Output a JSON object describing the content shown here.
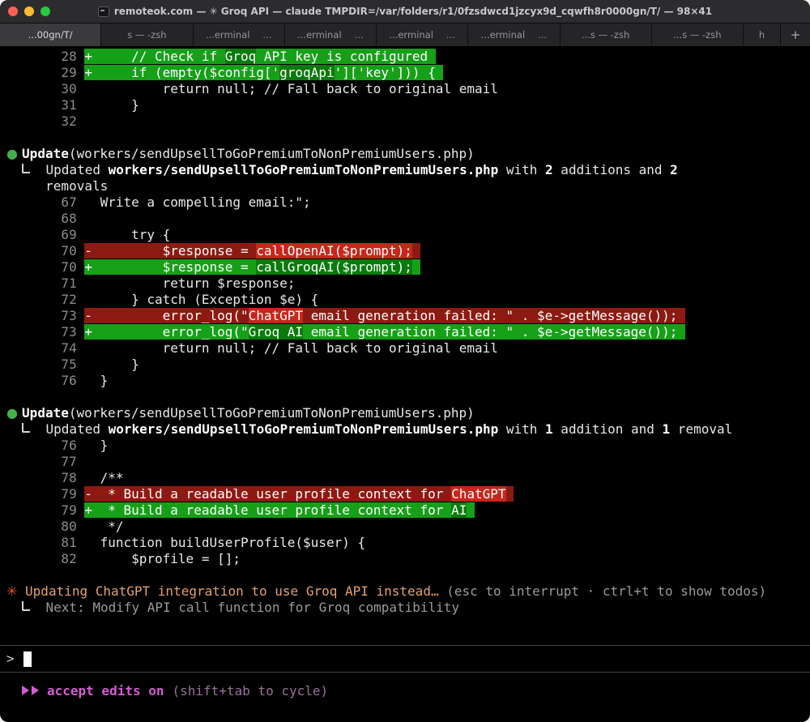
{
  "window": {
    "title": "remoteok.com — ✳ Groq API — claude TMPDIR=/var/folders/r1/0fzsdwcd1jzcyx9d_cqwfh8r0000gn/T/ — 98×41"
  },
  "tabbar": {
    "new_tab_label": "+",
    "tabs": [
      {
        "label": "...00gn/T/",
        "active": true
      },
      {
        "label": "s — -zsh"
      },
      {
        "label": "...erminal",
        "suffix": "..."
      },
      {
        "label": "...erminal",
        "suffix": "..."
      },
      {
        "label": "...erminal",
        "suffix": "..."
      },
      {
        "label": "...erminal",
        "suffix": "..."
      },
      {
        "label": "...s — -zsh"
      },
      {
        "label": "...s — -zsh"
      },
      {
        "label": "h",
        "narrow": true
      }
    ]
  },
  "colors": {
    "added_line_bg": "#16a018",
    "added_word_bg": "#0b7a0d",
    "removed_line_bg": "#8d1a12",
    "removed_word_bg": "#c8261a",
    "bullet_green": "#43b14b",
    "status_orange": "#e5a266",
    "spinner_orange": "#dd512e",
    "mode_magenta": "#d05ed0",
    "mode_magenta_dim": "#9a6f9e"
  },
  "input": {
    "prompt": ">"
  },
  "footer": {
    "icon": "fast-forward",
    "label": "accept edits on",
    "hint": "(shift+tab to cycle)"
  },
  "terminal": {
    "lines": [
      {
        "name": "diff-line-added",
        "parts": [
          {
            "t": "       28 ",
            "cls": "gutter"
          },
          {
            "t": "+     // Check if ",
            "cls": "add"
          },
          {
            "t": "Groq",
            "cls": "addhl"
          },
          {
            "t": " API key is configured ",
            "cls": "add"
          }
        ]
      },
      {
        "name": "diff-line-added",
        "parts": [
          {
            "t": "       29 ",
            "cls": "gutter"
          },
          {
            "t": "+     if (empty($config['",
            "cls": "add"
          },
          {
            "t": "groqApi",
            "cls": "addhl"
          },
          {
            "t": "']['key'])) { ",
            "cls": "add"
          }
        ]
      },
      {
        "name": "diff-context-line",
        "parts": [
          {
            "t": "       30 ",
            "cls": "gutter"
          },
          {
            "t": "          return null; // Fall back to original email",
            "cls": "ctx"
          }
        ]
      },
      {
        "name": "diff-context-line",
        "parts": [
          {
            "t": "       31 ",
            "cls": "gutter"
          },
          {
            "t": "      }",
            "cls": "ctx"
          }
        ]
      },
      {
        "name": "diff-context-line",
        "parts": [
          {
            "t": "       32",
            "cls": "gutter"
          }
        ]
      },
      {
        "name": "blank-line",
        "parts": []
      },
      {
        "name": "tool-call-header",
        "parts": [
          {
            "t": "● ",
            "cls": "bullet"
          },
          {
            "t": "Update",
            "cls": "b"
          },
          {
            "t": "(workers/sendUpsellToGoPremiumToNonPremiumUsers.php)",
            "cls": "ctx"
          }
        ]
      },
      {
        "name": "tool-result-summary",
        "parts": [
          {
            "t": "  ",
            "cls": "ctx"
          },
          {
            "icon": "elbow"
          },
          {
            "t": "  Updated ",
            "cls": "ctx"
          },
          {
            "t": "workers/sendUpsellToGoPremiumToNonPremiumUsers.php",
            "cls": "b"
          },
          {
            "t": " with ",
            "cls": "ctx"
          },
          {
            "t": "2",
            "cls": "b"
          },
          {
            "t": " additions and ",
            "cls": "ctx"
          },
          {
            "t": "2",
            "cls": "b"
          }
        ]
      },
      {
        "name": "tool-result-summary",
        "parts": [
          {
            "t": "     removals",
            "cls": "ctx"
          }
        ]
      },
      {
        "name": "diff-context-line",
        "parts": [
          {
            "t": "       67 ",
            "cls": "gutter"
          },
          {
            "t": "  Write a compelling email:\";",
            "cls": "ctx"
          }
        ]
      },
      {
        "name": "diff-context-line",
        "parts": [
          {
            "t": "       68",
            "cls": "gutter"
          }
        ]
      },
      {
        "name": "diff-context-line",
        "parts": [
          {
            "t": "       69 ",
            "cls": "gutter"
          },
          {
            "t": "      try {",
            "cls": "ctx"
          }
        ]
      },
      {
        "name": "diff-line-removed",
        "parts": [
          {
            "t": "       70 ",
            "cls": "gutter"
          },
          {
            "t": "-         $response = ",
            "cls": "del"
          },
          {
            "t": "callOpenAI($prompt);",
            "cls": "delhl"
          },
          {
            "t": " ",
            "cls": "del"
          }
        ]
      },
      {
        "name": "diff-line-added",
        "parts": [
          {
            "t": "       70 ",
            "cls": "gutter"
          },
          {
            "t": "+         $response = ",
            "cls": "add"
          },
          {
            "t": "callGroqAI($prompt);",
            "cls": "addhl"
          },
          {
            "t": " ",
            "cls": "add"
          }
        ]
      },
      {
        "name": "diff-context-line",
        "parts": [
          {
            "t": "       71 ",
            "cls": "gutter"
          },
          {
            "t": "          return $response;",
            "cls": "ctx"
          }
        ]
      },
      {
        "name": "diff-context-line",
        "parts": [
          {
            "t": "       72 ",
            "cls": "gutter"
          },
          {
            "t": "      } catch (Exception $e) {",
            "cls": "ctx"
          }
        ]
      },
      {
        "name": "diff-line-removed",
        "parts": [
          {
            "t": "       73 ",
            "cls": "gutter"
          },
          {
            "t": "-         error_log(\"",
            "cls": "del"
          },
          {
            "t": "ChatGPT",
            "cls": "delhl"
          },
          {
            "t": " email generation failed: \" . $e->getMessage()); ",
            "cls": "del"
          }
        ]
      },
      {
        "name": "diff-line-added",
        "parts": [
          {
            "t": "       73 ",
            "cls": "gutter"
          },
          {
            "t": "+         error_log(\"",
            "cls": "add"
          },
          {
            "t": "Groq AI",
            "cls": "addhl"
          },
          {
            "t": " email generation failed: \" . $e->getMessage()); ",
            "cls": "add"
          }
        ]
      },
      {
        "name": "diff-context-line",
        "parts": [
          {
            "t": "       74 ",
            "cls": "gutter"
          },
          {
            "t": "          return null; // Fall back to original email",
            "cls": "ctx"
          }
        ]
      },
      {
        "name": "diff-context-line",
        "parts": [
          {
            "t": "       75 ",
            "cls": "gutter"
          },
          {
            "t": "      }",
            "cls": "ctx"
          }
        ]
      },
      {
        "name": "diff-context-line",
        "parts": [
          {
            "t": "       76 ",
            "cls": "gutter"
          },
          {
            "t": "  }",
            "cls": "ctx"
          }
        ]
      },
      {
        "name": "blank-line",
        "parts": []
      },
      {
        "name": "tool-call-header",
        "parts": [
          {
            "t": "● ",
            "cls": "bullet"
          },
          {
            "t": "Update",
            "cls": "b"
          },
          {
            "t": "(workers/sendUpsellToGoPremiumToNonPremiumUsers.php)",
            "cls": "ctx"
          }
        ]
      },
      {
        "name": "tool-result-summary",
        "parts": [
          {
            "t": "  ",
            "cls": "ctx"
          },
          {
            "icon": "elbow"
          },
          {
            "t": "  Updated ",
            "cls": "ctx"
          },
          {
            "t": "workers/sendUpsellToGoPremiumToNonPremiumUsers.php",
            "cls": "b"
          },
          {
            "t": " with ",
            "cls": "ctx"
          },
          {
            "t": "1",
            "cls": "b"
          },
          {
            "t": " addition and ",
            "cls": "ctx"
          },
          {
            "t": "1",
            "cls": "b"
          },
          {
            "t": " removal",
            "cls": "ctx"
          }
        ]
      },
      {
        "name": "diff-context-line",
        "parts": [
          {
            "t": "       76 ",
            "cls": "gutter"
          },
          {
            "t": "  }",
            "cls": "ctx"
          }
        ]
      },
      {
        "name": "diff-context-line",
        "parts": [
          {
            "t": "       77",
            "cls": "gutter"
          }
        ]
      },
      {
        "name": "diff-context-line",
        "parts": [
          {
            "t": "       78 ",
            "cls": "gutter"
          },
          {
            "t": "  /**",
            "cls": "ctx"
          }
        ]
      },
      {
        "name": "diff-line-removed",
        "parts": [
          {
            "t": "       79 ",
            "cls": "gutter"
          },
          {
            "t": "-  * Build a readable user profile context for ",
            "cls": "del"
          },
          {
            "t": "ChatGPT",
            "cls": "delhl"
          },
          {
            "t": " ",
            "cls": "del"
          }
        ]
      },
      {
        "name": "diff-line-added",
        "parts": [
          {
            "t": "       79 ",
            "cls": "gutter"
          },
          {
            "t": "+  * Build a readable user profile context for ",
            "cls": "add"
          },
          {
            "t": "AI",
            "cls": "addhl"
          },
          {
            "t": " ",
            "cls": "add"
          }
        ]
      },
      {
        "name": "diff-context-line",
        "parts": [
          {
            "t": "       80 ",
            "cls": "gutter"
          },
          {
            "t": "   */",
            "cls": "ctx"
          }
        ]
      },
      {
        "name": "diff-context-line",
        "parts": [
          {
            "t": "       81 ",
            "cls": "gutter"
          },
          {
            "t": "  function buildUserProfile($user) {",
            "cls": "ctx"
          }
        ]
      },
      {
        "name": "diff-context-line",
        "parts": [
          {
            "t": "       82 ",
            "cls": "gutter"
          },
          {
            "t": "      $profile = [];",
            "cls": "ctx"
          }
        ]
      },
      {
        "name": "blank-line",
        "parts": []
      },
      {
        "name": "status-line",
        "parts": [
          {
            "t": "✳",
            "cls": "star"
          },
          {
            "t": " Updating ChatGPT integration to use Groq API instead… ",
            "cls": "status"
          },
          {
            "t": "(esc to interrupt · ctrl+t to show todos)",
            "cls": "dim"
          }
        ]
      },
      {
        "name": "todo-next-line",
        "parts": [
          {
            "t": "  ",
            "cls": "ctx"
          },
          {
            "icon": "elbow"
          },
          {
            "t": "  Next: Modify API call function for Groq compatibility",
            "cls": "dim"
          }
        ]
      }
    ]
  }
}
